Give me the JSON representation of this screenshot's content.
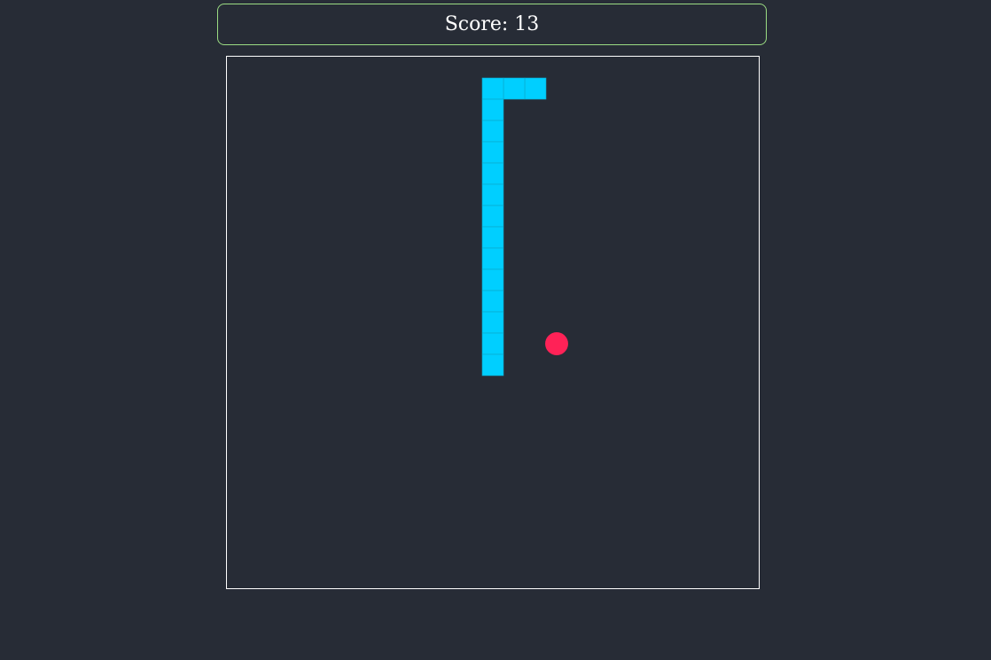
{
  "score": {
    "label": "Score:",
    "value": 13,
    "text": "Score: 13"
  },
  "game": {
    "grid_columns": 25,
    "grid_rows": 25,
    "snake_color": "#00cfff",
    "snake_border_color": "#0aa6c8",
    "food_color": "#ff2257",
    "board_border_color": "#ffffff",
    "score_border_color": "#9bdc83",
    "background_color": "#272c36",
    "snake": [
      {
        "col": 14,
        "row": 1
      },
      {
        "col": 13,
        "row": 1
      },
      {
        "col": 12,
        "row": 1
      },
      {
        "col": 12,
        "row": 2
      },
      {
        "col": 12,
        "row": 3
      },
      {
        "col": 12,
        "row": 4
      },
      {
        "col": 12,
        "row": 5
      },
      {
        "col": 12,
        "row": 6
      },
      {
        "col": 12,
        "row": 7
      },
      {
        "col": 12,
        "row": 8
      },
      {
        "col": 12,
        "row": 9
      },
      {
        "col": 12,
        "row": 10
      },
      {
        "col": 12,
        "row": 11
      },
      {
        "col": 12,
        "row": 12
      },
      {
        "col": 12,
        "row": 13
      },
      {
        "col": 12,
        "row": 14
      }
    ],
    "food": {
      "col": 15,
      "row": 13
    }
  }
}
